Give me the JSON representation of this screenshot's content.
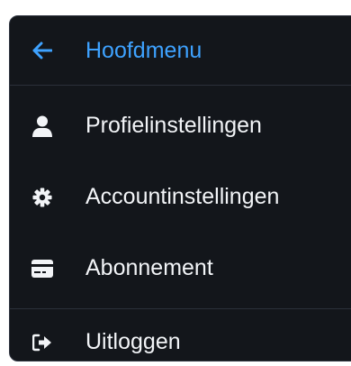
{
  "menu": {
    "back": {
      "label": "Hoofdmenu",
      "icon": "arrow-left-icon"
    },
    "items": [
      {
        "label": "Profielinstellingen",
        "icon": "user-icon"
      },
      {
        "label": "Accountinstellingen",
        "icon": "gear-icon"
      },
      {
        "label": "Abonnement",
        "icon": "credit-card-icon"
      }
    ],
    "logout": {
      "label": "Uitloggen",
      "icon": "sign-out-icon"
    }
  },
  "colors": {
    "background": "#13161b",
    "accent": "#3ea2ff",
    "text": "#f2f4f7",
    "divider": "#2b303a"
  }
}
